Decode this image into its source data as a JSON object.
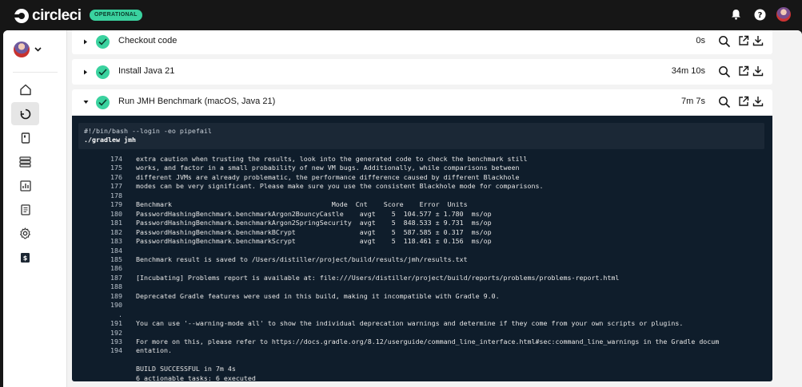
{
  "topbar": {
    "logo_text": "circleci",
    "status": "OPERATIONAL",
    "icons": [
      "bell-icon",
      "help-icon",
      "user-avatar"
    ]
  },
  "sidebar": {
    "items": [
      {
        "name": "home-icon",
        "active": false
      },
      {
        "name": "pipelines-icon",
        "active": true
      },
      {
        "name": "projects-icon",
        "active": false
      },
      {
        "name": "deploys-icon",
        "active": false
      },
      {
        "name": "insights-icon",
        "active": false
      },
      {
        "name": "orbs-icon",
        "active": false
      },
      {
        "name": "settings-icon",
        "active": false
      },
      {
        "name": "plan-icon",
        "active": false
      }
    ]
  },
  "steps": [
    {
      "title": "Checkout code",
      "time": "0s",
      "expanded": false
    },
    {
      "title": "Install Java 21",
      "time": "34m 10s",
      "expanded": false
    },
    {
      "title": "Run JMH Benchmark (macOS, Java 21)",
      "time": "7m 7s",
      "expanded": true
    }
  ],
  "console": {
    "command": [
      "#!/bin/bash --login -eo pipefail",
      "./gradlew jmh"
    ],
    "lines": [
      {
        "n": "174",
        "t": "extra caution when trusting the results, look into the generated code to check the benchmark still"
      },
      {
        "n": "175",
        "t": "works, and factor in a small probability of new VM bugs. Additionally, while comparisons between"
      },
      {
        "n": "176",
        "t": "different JVMs are already problematic, the performance difference caused by different Blackhole"
      },
      {
        "n": "177",
        "t": "modes can be very significant. Please make sure you use the consistent Blackhole mode for comparisons."
      },
      {
        "n": "178",
        "t": ""
      },
      {
        "n": "179",
        "t": "Benchmark                                        Mode  Cnt    Score    Error  Units"
      },
      {
        "n": "180",
        "t": "PasswordHashingBenchmark.benchmarkArgon2BouncyCastle    avgt    5  104.577 ± 1.780  ms/op"
      },
      {
        "n": "181",
        "t": "PasswordHashingBenchmark.benchmarkArgon2SpringSecurity  avgt    5  848.533 ± 9.731  ms/op"
      },
      {
        "n": "182",
        "t": "PasswordHashingBenchmark.benchmarkBCrypt                avgt    5  587.585 ± 0.317  ms/op"
      },
      {
        "n": "183",
        "t": "PasswordHashingBenchmark.benchmarkScrypt                avgt    5  118.461 ± 0.156  ms/op"
      },
      {
        "n": "184",
        "t": ""
      },
      {
        "n": "185",
        "t": "Benchmark result is saved to /Users/distiller/project/build/results/jmh/results.txt"
      },
      {
        "n": "186",
        "t": ""
      },
      {
        "n": "187",
        "t": "[Incubating] Problems report is available at: file:///Users/distiller/project/build/reports/problems/problems-report.html"
      },
      {
        "n": "188",
        "t": ""
      },
      {
        "n": "189",
        "t": "Deprecated Gradle features were used in this build, making it incompatible with Gradle 9.0."
      },
      {
        "n": "190",
        "t": ""
      },
      {
        "n": ".",
        "t": ""
      },
      {
        "n": "191",
        "t": "You can use '--warning-mode all' to show the individual deprecation warnings and determine if they come from your own scripts or plugins."
      },
      {
        "n": "192",
        "t": ""
      },
      {
        "n": "193",
        "t": "For more on this, please refer to https://docs.gradle.org/8.12/userguide/command_line_interface.html#sec:command_line_warnings in the Gradle docum"
      },
      {
        "n": "194",
        "t": "entation."
      },
      {
        "n": "",
        "t": ""
      },
      {
        "n": "",
        "t": "BUILD SUCCESSFUL in 7m 4s"
      },
      {
        "n": "",
        "t": "6 actionable tasks: 6 executed"
      }
    ]
  }
}
